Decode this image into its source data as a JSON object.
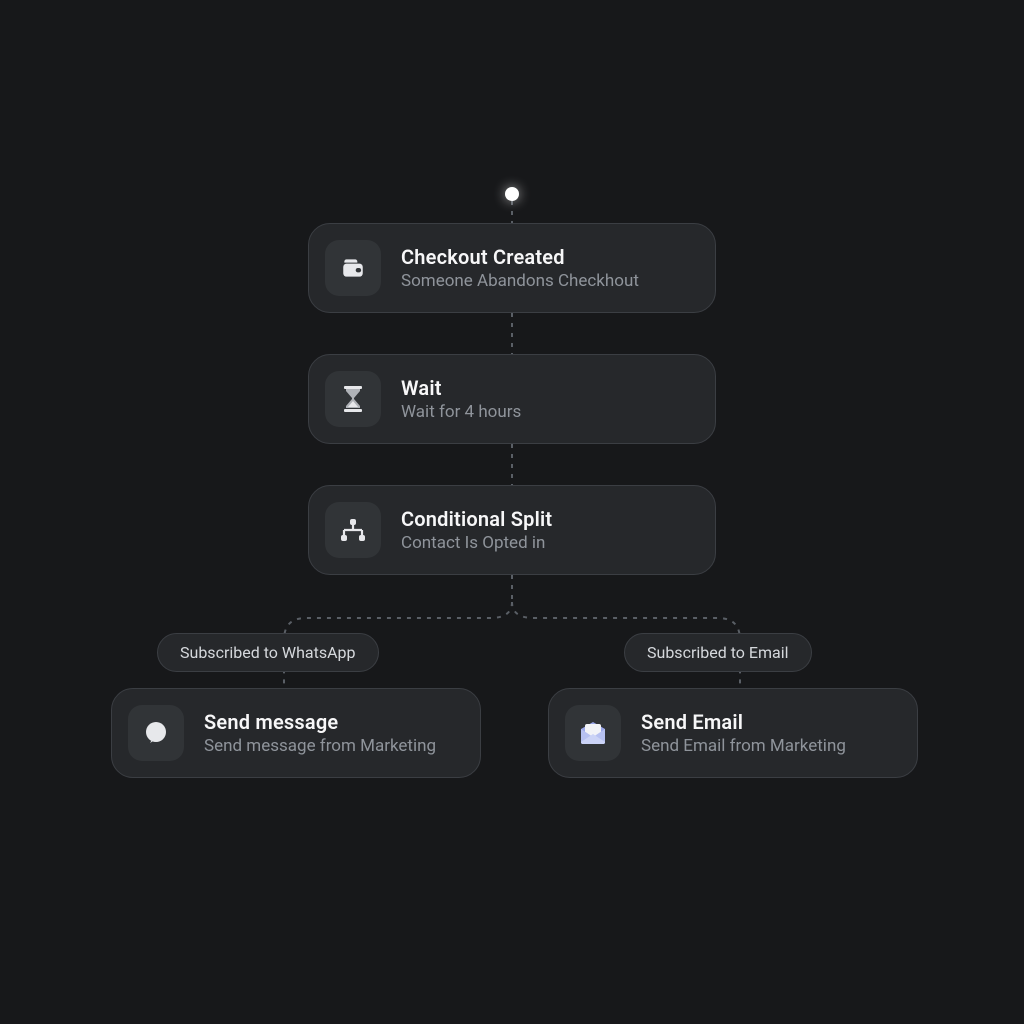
{
  "nodes": {
    "trigger": {
      "title": "Checkout Created",
      "subtitle": "Someone Abandons Checkhout",
      "icon": "wallet-icon"
    },
    "wait": {
      "title": "Wait",
      "subtitle": "Wait for 4 hours",
      "icon": "hourglass-icon"
    },
    "split": {
      "title": "Conditional Split",
      "subtitle": "Contact Is Opted in",
      "icon": "split-icon"
    },
    "left": {
      "title": "Send message",
      "subtitle": "Send message from Marketing",
      "icon": "chat-icon"
    },
    "right": {
      "title": "Send Email",
      "subtitle": "Send Email from Marketing",
      "icon": "email-icon"
    }
  },
  "branches": {
    "left_label": "Subscribed to WhatsApp",
    "right_label": "Subscribed to Email"
  },
  "colors": {
    "bg": "#17181A",
    "card": "#26282B",
    "border": "#3B3E43",
    "icon_tile": "#313437",
    "text": "#F7F7F8",
    "muted": "#8F949B"
  }
}
